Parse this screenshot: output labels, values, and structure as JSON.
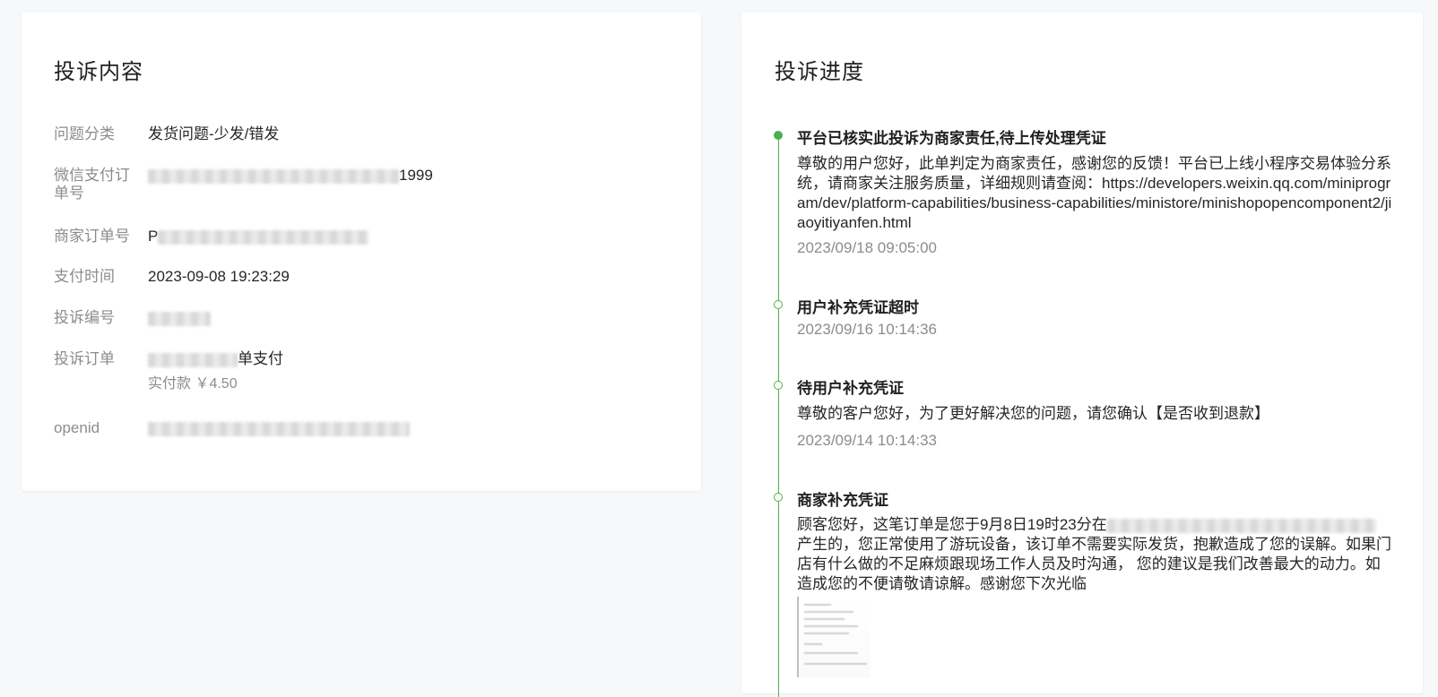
{
  "complaint": {
    "title": "投诉内容",
    "fields": [
      {
        "label": "问题分类",
        "value": "发货问题-少发/错发"
      },
      {
        "label": "微信支付订单号",
        "value": "1999"
      },
      {
        "label": "商家订单号",
        "value": "P"
      },
      {
        "label": "支付时间",
        "value": "2023-09-08 19:23:29"
      },
      {
        "label": "投诉编号",
        "value": ""
      },
      {
        "label": "投诉订单",
        "value": "单支付",
        "sub": "实付款 ￥4.50"
      },
      {
        "label": "openid",
        "value": ""
      }
    ]
  },
  "progress": {
    "title": "投诉进度",
    "entries": [
      {
        "title": "平台已核实此投诉为商家责任,待上传处理凭证",
        "text": "尊敬的用户您好，此单判定为商家责任，感谢您的反馈！平台已上线小程序交易体验分系统，请商家关注服务质量，详细规则请查阅：https://developers.weixin.qq.com/miniprogram/dev/platform-capabilities/business-capabilities/ministore/minishopopencomponent2/jiaoyitiyanfen.html",
        "time": "2023/09/18 09:05:00"
      },
      {
        "title": "用户补充凭证超时",
        "text": "",
        "time": "2023/09/16 10:14:36"
      },
      {
        "title": "待用户补充凭证",
        "text": "尊敬的客户您好，为了更好解决您的问题，请您确认【是否收到退款】",
        "time": "2023/09/14 10:14:33"
      },
      {
        "title": "商家补充凭证",
        "text": "顾客您好，这笔订单是您于9月8日19时23分在",
        "text2": "产生的，您正常使用了游玩设备，该订单不需要实际发货，抱歉造成了您的误解。如果门店有什么做的不足麻烦跟现场工作人员及时沟通， 您的建议是我们改善最大的动力。如造成您的不便请敬请谅解。感谢您下次光临",
        "time": ""
      }
    ]
  },
  "colors": {
    "accent": "#4caf50",
    "label": "#8c8c8c",
    "text": "#262626"
  }
}
